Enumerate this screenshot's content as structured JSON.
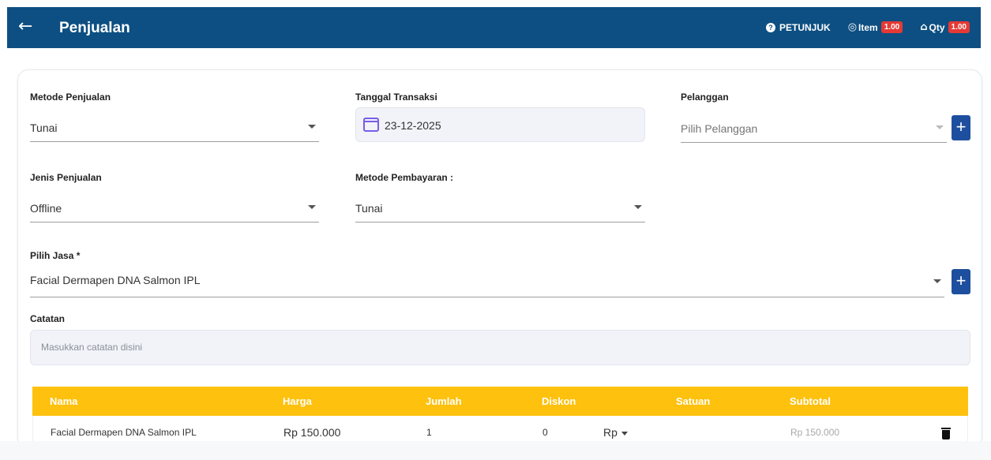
{
  "header": {
    "back_icon": "arrow-left-icon",
    "title": "Penjualan",
    "help_label": "PETUNJUK",
    "item_label": "Item",
    "item_badge": "1.00",
    "qty_label": "Qty",
    "qty_badge": "1.00",
    "bg_color": "#0d4f82",
    "badge_color": "#e53935"
  },
  "form": {
    "metode_penjualan": {
      "label": "Metode Penjualan",
      "value": "Tunai"
    },
    "tanggal_transaksi": {
      "label": "Tanggal Transaksi",
      "value": "23-12-2025",
      "icon": "calendar-icon"
    },
    "pelanggan": {
      "label": "Pelanggan",
      "placeholder": "Pilih Pelanggan"
    },
    "jenis_penjualan": {
      "label": "Jenis Penjualan",
      "value": "Offline"
    },
    "metode_pembayaran": {
      "label": "Metode Pembayaran :",
      "value": "Tunai"
    },
    "pilih_jasa": {
      "label": "Pilih Jasa *",
      "value": "Facial Dermapen DNA Salmon IPL"
    },
    "catatan": {
      "label": "Catatan",
      "placeholder": "Masukkan catatan disini"
    },
    "add_button": "+"
  },
  "table": {
    "header_color": "#fdc10e",
    "columns": [
      "Nama",
      "Harga",
      "Jumlah",
      "Diskon",
      "Satuan",
      "Subtotal"
    ],
    "rows": [
      {
        "nama": "Facial Dermapen DNA Salmon IPL",
        "harga": "Rp 150.000",
        "jumlah": "1",
        "diskon": "0",
        "diskon_unit": "Rp",
        "satuan": "",
        "subtotal": "Rp 150.000"
      }
    ]
  }
}
